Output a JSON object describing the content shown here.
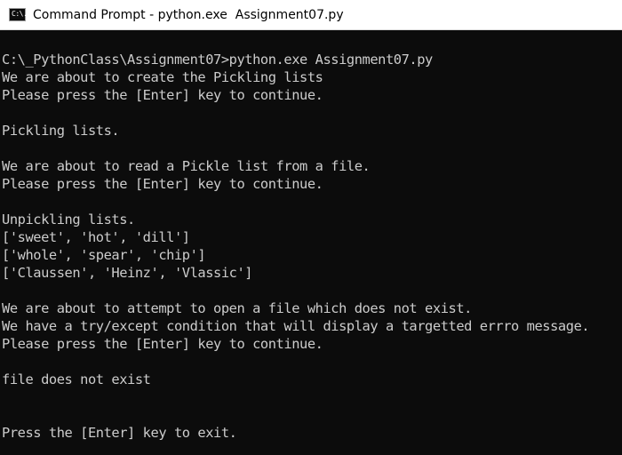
{
  "window": {
    "title": "Command Prompt - python.exe  Assignment07.py",
    "icon_label": "C:\\."
  },
  "console": {
    "lines": [
      "C:\\_PythonClass\\Assignment07>python.exe Assignment07.py",
      "We are about to create the Pickling lists",
      "Please press the [Enter] key to continue.",
      "",
      "Pickling lists.",
      "",
      "We are about to read a Pickle list from a file.",
      "Please press the [Enter] key to continue.",
      "",
      "Unpickling lists.",
      "['sweet', 'hot', 'dill']",
      "['whole', 'spear', 'chip']",
      "['Claussen', 'Heinz', 'Vlassic']",
      "",
      "We are about to attempt to open a file which does not exist.",
      "We have a try/except condition that will display a targetted errro message.",
      "Please press the [Enter] key to continue.",
      "",
      "file does not exist",
      "",
      "",
      "Press the [Enter] key to exit."
    ]
  },
  "colors": {
    "console_background": "#0c0c0c",
    "console_text": "#cccccc",
    "titlebar_background": "#ffffff"
  }
}
